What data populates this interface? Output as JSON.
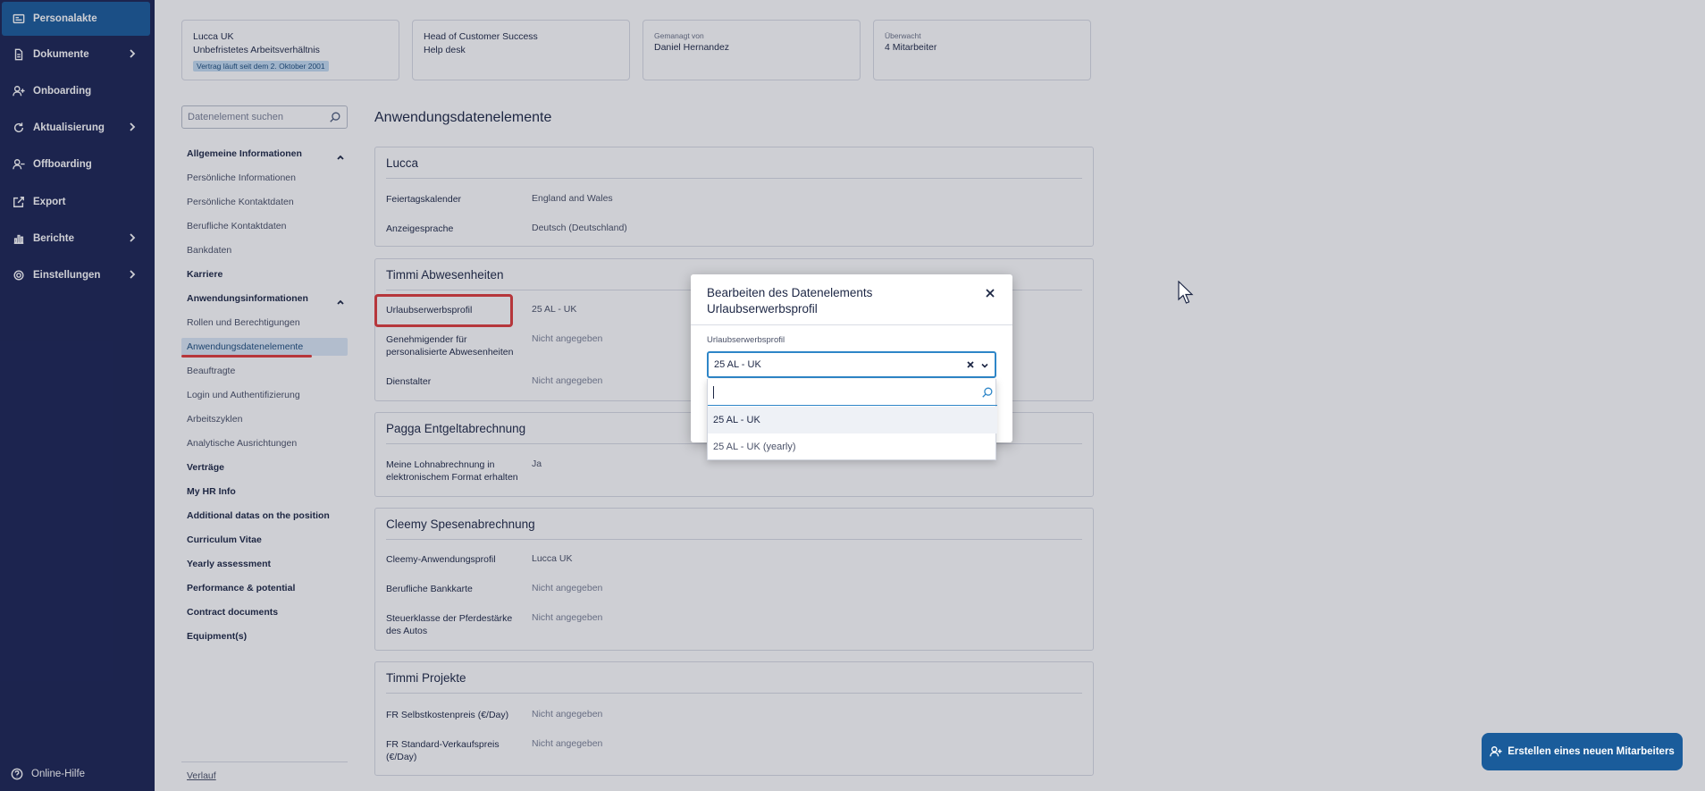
{
  "sidebar": {
    "items": [
      {
        "label": "Personalakte",
        "icon": "id-card-icon",
        "active": true,
        "chevron": false
      },
      {
        "label": "Dokumente",
        "icon": "document-icon",
        "chevron": true
      },
      {
        "label": "Onboarding",
        "icon": "user-plus-icon",
        "chevron": false
      },
      {
        "label": "Aktualisierung",
        "icon": "refresh-icon",
        "chevron": true
      },
      {
        "label": "Offboarding",
        "icon": "user-minus-icon",
        "chevron": false
      },
      {
        "label": "Export",
        "icon": "export-icon",
        "chevron": false
      },
      {
        "label": "Berichte",
        "icon": "chart-icon",
        "chevron": true
      },
      {
        "label": "Einstellungen",
        "icon": "gear-icon",
        "chevron": true
      }
    ],
    "help": "Online-Hilfe"
  },
  "cards": [
    {
      "line1": "Lucca UK",
      "line2": "Unbefristetes Arbeitsverhältnis",
      "badge": "Vertrag läuft seit dem 2. Oktober 2001"
    },
    {
      "line1": "Head of Customer Success",
      "line2": "Help desk"
    },
    {
      "small": "Gemanagt von",
      "line1": "Daniel Hernandez"
    },
    {
      "small": "Überwacht",
      "line1": "4 Mitarbeiter"
    }
  ],
  "left_menu": {
    "search_placeholder": "Datenelement suchen",
    "items": [
      {
        "label": "Allgemeine Informationen",
        "bold": true,
        "caret": true
      },
      {
        "label": "Persönliche Informationen"
      },
      {
        "label": "Persönliche Kontaktdaten"
      },
      {
        "label": "Berufliche Kontaktdaten"
      },
      {
        "label": "Bankdaten"
      },
      {
        "label": "Karriere",
        "bold": true
      },
      {
        "label": "Anwendungsinformationen",
        "bold": true,
        "caret": true
      },
      {
        "label": "Rollen und Berechtigungen"
      },
      {
        "label": "Anwendungsdatenelemente",
        "selected": true
      },
      {
        "label": "Beauftragte"
      },
      {
        "label": "Login und Authentifizierung"
      },
      {
        "label": "Arbeitszyklen"
      },
      {
        "label": "Analytische Ausrichtungen"
      },
      {
        "label": "Verträge",
        "bold": true
      },
      {
        "label": "My HR Info",
        "bold": true
      },
      {
        "label": "Additional datas on the position",
        "bold": true
      },
      {
        "label": "Curriculum Vitae",
        "bold": true
      },
      {
        "label": "Yearly assessment",
        "bold": true
      },
      {
        "label": "Performance & potential",
        "bold": true
      },
      {
        "label": "Contract documents",
        "bold": true
      },
      {
        "label": "Equipment(s)",
        "bold": true
      }
    ],
    "verlauf": "Verlauf"
  },
  "content": {
    "title": "Anwendungsdatenelemente",
    "sections": [
      {
        "title": "Lucca",
        "rows": [
          {
            "label": "Feiertagskalender",
            "value": "England and Wales"
          },
          {
            "label": "Anzeigesprache",
            "value": "Deutsch (Deutschland)"
          }
        ]
      },
      {
        "title": "Timmi Abwesenheiten",
        "rows": [
          {
            "label": "Urlaubserwerbsprofil",
            "value": "25 AL - UK"
          },
          {
            "label": "Genehmigender für personalisierte Abwesenheiten",
            "value": "Nicht angegeben"
          },
          {
            "label": "Dienstalter",
            "value": "Nicht angegeben"
          }
        ]
      },
      {
        "title": "Pagga Entgeltabrechnung",
        "rows": [
          {
            "label": "Meine Lohnabrechnung in elektronischem Format erhalten",
            "value": "Ja"
          }
        ]
      },
      {
        "title": "Cleemy Spesenabrechnung",
        "rows": [
          {
            "label": "Cleemy-Anwendungsprofil",
            "value": "Lucca UK"
          },
          {
            "label": "Berufliche Bankkarte",
            "value": "Nicht angegeben"
          },
          {
            "label": "Steuerklasse der Pferdestärke des Autos",
            "value": "Nicht angegeben"
          }
        ]
      },
      {
        "title": "Timmi Projekte",
        "rows": [
          {
            "label": "FR Selbstkostenpreis (€/Day)",
            "value": "Nicht angegeben"
          },
          {
            "label": "FR Standard-Verkaufspreis (€/Day)",
            "value": "Nicht angegeben"
          }
        ]
      }
    ]
  },
  "modal": {
    "title": "Bearbeiten des Datenelements Urlaubserwerbsprofil",
    "field_label": "Urlaubserwerbsprofil",
    "selected_value": "25 AL - UK",
    "options": [
      "25 AL - UK",
      "25 AL - UK (yearly)"
    ]
  },
  "fab": {
    "label": "Erstellen eines neuen Mitarbeiters"
  }
}
